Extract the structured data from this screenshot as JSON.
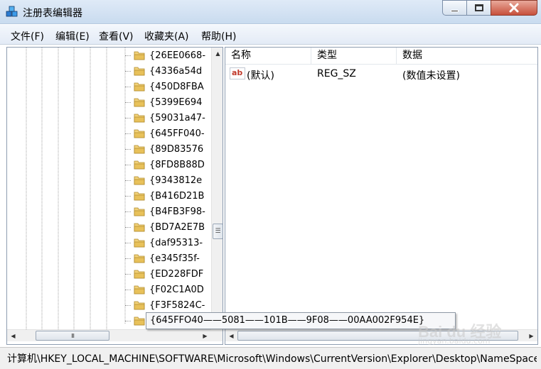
{
  "window": {
    "title": "注册表编辑器"
  },
  "menu": [
    "文件(F)",
    "编辑(E)",
    "查看(V)",
    "收藏夹(A)",
    "帮助(H)"
  ],
  "tree": {
    "items": [
      "{26EE0668-",
      "{4336a54d",
      "{450D8FBA",
      "{5399E694",
      "{59031a47-",
      "{645FF040-",
      "{89D83576",
      "{8FD8B88D",
      "{9343812e",
      "{B416D21B",
      "{B4FB3F98-",
      "{BD7A2E7B",
      "{daf95313-",
      "{e345f35f-",
      "{ED228FDF",
      "{F02C1A0D",
      "{F3F5824C-",
      ""
    ]
  },
  "tooltip": {
    "text": "{645FFO40——5081——101B——9F08——00AA002F954E}"
  },
  "list": {
    "headers": {
      "name": "名称",
      "type": "类型",
      "data": "数据"
    },
    "rows": [
      {
        "name": "(默认)",
        "type": "REG_SZ",
        "data": "(数值未设置)"
      }
    ]
  },
  "statusbar": {
    "path": "计算机\\HKEY_LOCAL_MACHINE\\SOFTWARE\\Microsoft\\Windows\\CurrentVersion\\Explorer\\Desktop\\NameSpace"
  },
  "scroll": {
    "scroll_up": "▲",
    "scroll_down": "▼",
    "scroll_left": "◀",
    "scroll_right": "▶",
    "grip": "☰",
    "hgrip": "III"
  },
  "watermark": {
    "brand": "Bai du 经验",
    "sub": "jingyan.baidu.com"
  },
  "colors": {
    "titlebar": "#c9dbef",
    "close_button": "#c7503b",
    "folder": "#e8c15a",
    "ab_icon": "#c0392b"
  },
  "icons": {
    "app": "registry-cubes-icon",
    "folder": "folder-icon",
    "value": "ab-string-icon"
  }
}
